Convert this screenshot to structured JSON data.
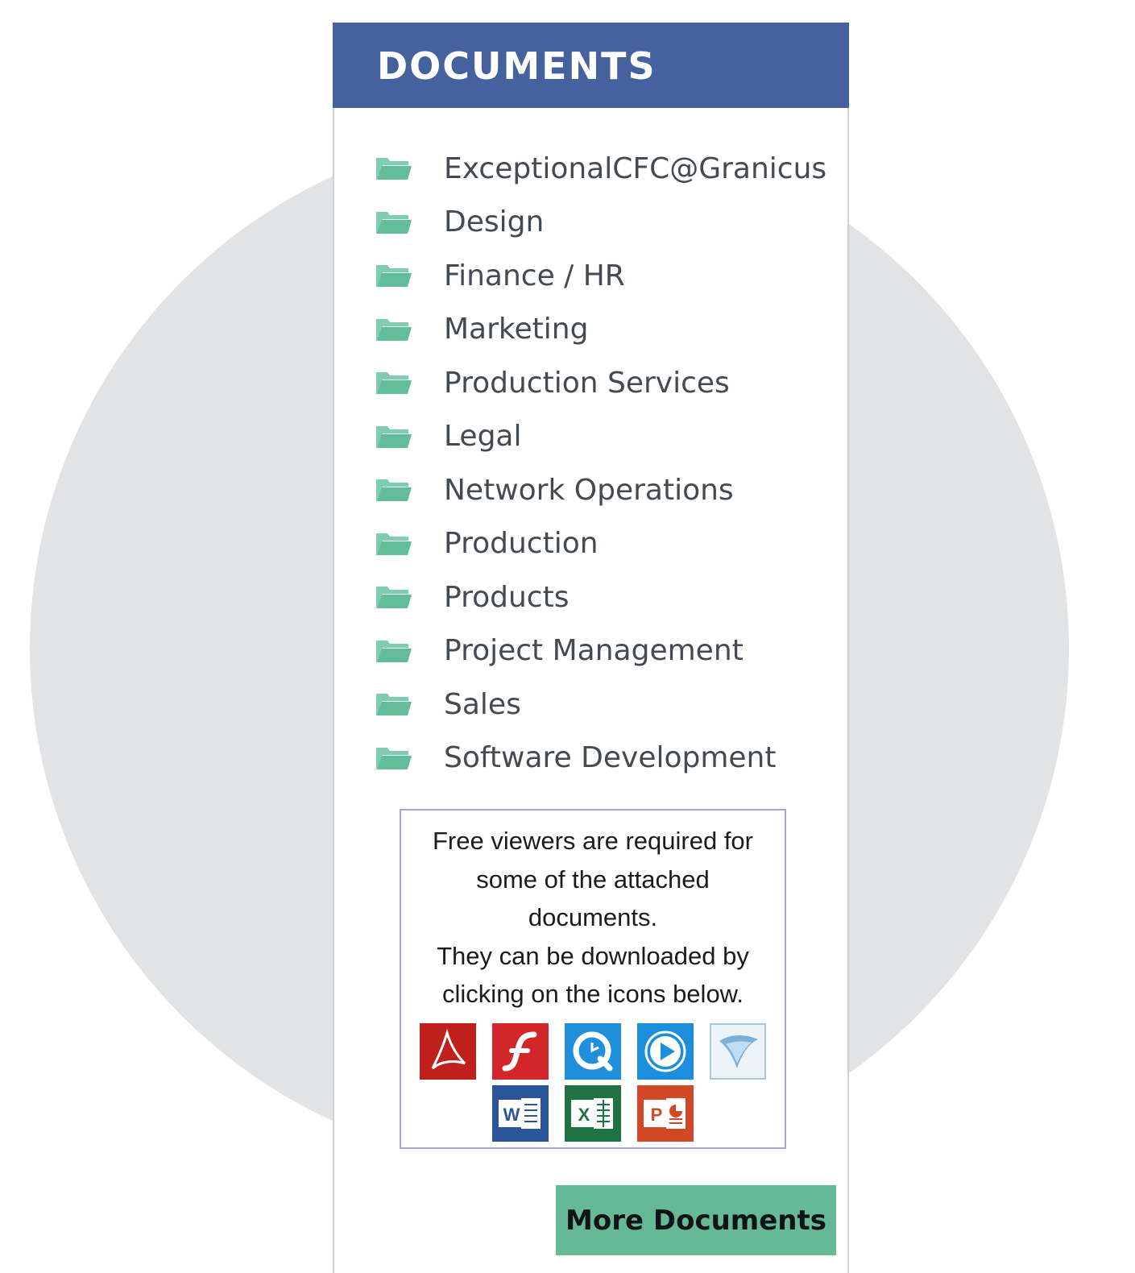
{
  "panel": {
    "title": "DOCUMENTS"
  },
  "folders": [
    {
      "label": "ExceptionalCFC@Granicus"
    },
    {
      "label": "Design"
    },
    {
      "label": "Finance / HR"
    },
    {
      "label": "Marketing"
    },
    {
      "label": "Production Services"
    },
    {
      "label": "Legal"
    },
    {
      "label": "Network Operations"
    },
    {
      "label": "Production"
    },
    {
      "label": "Products"
    },
    {
      "label": "Project Management"
    },
    {
      "label": "Sales"
    },
    {
      "label": "Software Development"
    }
  ],
  "viewers": {
    "lines": [
      "Free viewers are required for",
      "some of the attached",
      "documents.",
      "They can be downloaded by",
      "clicking on the icons below."
    ],
    "icons_row1": [
      "adobe-reader-icon",
      "flash-player-icon",
      "quicktime-icon",
      "windows-media-player-icon",
      "silverlight-icon"
    ],
    "icons_row2": [
      "word-viewer-icon",
      "excel-viewer-icon",
      "powerpoint-viewer-icon"
    ]
  },
  "more_button": {
    "label": "More Documents"
  },
  "colors": {
    "header": "#45619e",
    "folder_icon": "#6cc4a1",
    "button": "#65b995",
    "background_circle": "#e2e3e5"
  }
}
